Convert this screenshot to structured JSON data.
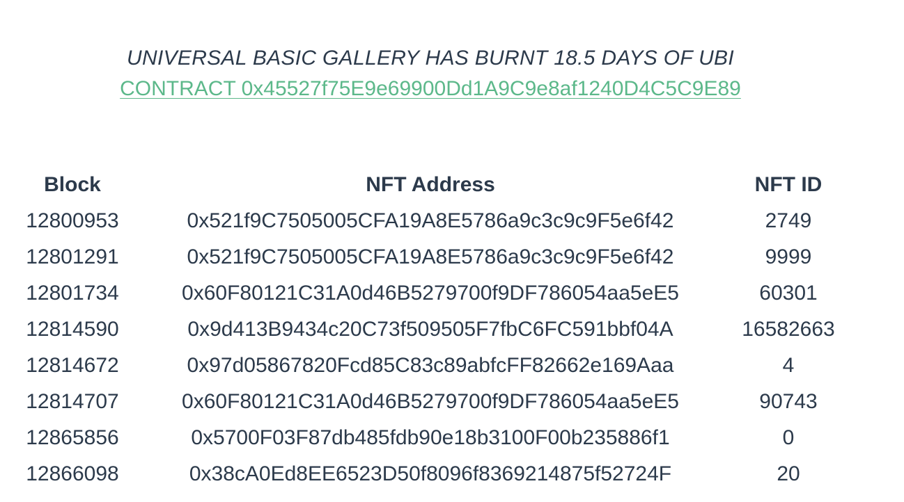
{
  "header": {
    "headline": "UNIVERSAL BASIC GALLERY HAS BURNT 18.5 DAYS OF UBI",
    "contract_link": "CONTRACT 0x45527f75E9e69900Dd1A9C9e8af1240D4C5C9E89"
  },
  "table": {
    "columns": [
      "Block",
      "NFT Address",
      "NFT ID"
    ],
    "rows": [
      {
        "block": "12800953",
        "address": "0x521f9C7505005CFA19A8E5786a9c3c9c9F5e6f42",
        "id": "2749"
      },
      {
        "block": "12801291",
        "address": "0x521f9C7505005CFA19A8E5786a9c3c9c9F5e6f42",
        "id": "9999"
      },
      {
        "block": "12801734",
        "address": "0x60F80121C31A0d46B5279700f9DF786054aa5eE5",
        "id": "60301"
      },
      {
        "block": "12814590",
        "address": "0x9d413B9434c20C73f509505F7fbC6FC591bbf04A",
        "id": "16582663"
      },
      {
        "block": "12814672",
        "address": "0x97d05867820Fcd85C83c89abfcFF82662e169Aaa",
        "id": "4"
      },
      {
        "block": "12814707",
        "address": "0x60F80121C31A0d46B5279700f9DF786054aa5eE5",
        "id": "90743"
      },
      {
        "block": "12865856",
        "address": "0x5700F03F87db485fdb90e18b3100F00b235886f1",
        "id": "0"
      },
      {
        "block": "12866098",
        "address": "0x38cA0Ed8EE6523D50f8096f8369214875f52724F",
        "id": "20"
      }
    ]
  },
  "colors": {
    "text": "#2c3a4b",
    "link": "#5cb88a",
    "background": "#ffffff"
  }
}
